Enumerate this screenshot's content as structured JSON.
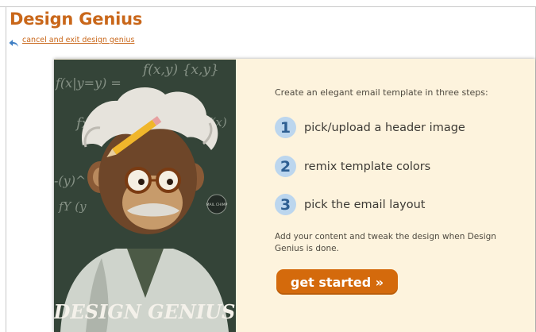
{
  "header": {
    "title": "Design Genius",
    "cancel_link": "cancel and exit design genius"
  },
  "illustration": {
    "caption": "DESIGN GENIUS",
    "chalk_formulas": [
      "f(x,y) {x,y}",
      "f(x|y=y) =",
      "fx",
      "f(x)",
      "-(y)^",
      "fY (y",
      "(x,y)"
    ],
    "badge_text": "MAIL CHIMP"
  },
  "content": {
    "intro": "Create an elegant email template in three steps:",
    "steps": [
      {
        "number": "1",
        "label": "pick/upload a header image"
      },
      {
        "number": "2",
        "label": "remix template colors"
      },
      {
        "number": "3",
        "label": "pick the email layout"
      }
    ],
    "outro": "Add your content and tweak the design when Design Genius is done.",
    "cta_label": "get started »"
  },
  "colors": {
    "brand_orange": "#c9671a",
    "button_orange": "#d46a0c",
    "card_background": "#fdf3dd",
    "step_circle": "#bcd6ee",
    "step_number": "#2e5f92",
    "chalkboard": "#3b4a3d"
  }
}
